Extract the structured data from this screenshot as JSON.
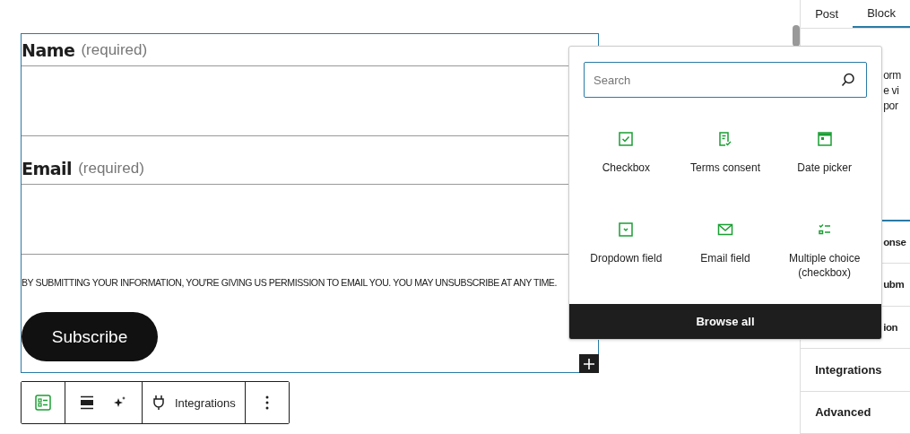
{
  "form": {
    "fields": [
      {
        "label": "Name",
        "hint": "(required)"
      },
      {
        "label": "Email",
        "hint": "(required)"
      }
    ],
    "disclaimer": "BY SUBMITTING YOUR INFORMATION, YOU'RE GIVING US PERMISSION TO EMAIL YOU. YOU MAY UNSUBSCRIBE AT ANY TIME.",
    "submit": "Subscribe"
  },
  "toolbar": {
    "integrations": "Integrations"
  },
  "inserter": {
    "search": {
      "placeholder": "Search"
    },
    "blocks": [
      {
        "label": "Checkbox",
        "kind": "checkbox"
      },
      {
        "label": "Terms consent",
        "kind": "consent"
      },
      {
        "label": "Date picker",
        "kind": "date"
      },
      {
        "label": "Dropdown field",
        "kind": "dropdown"
      },
      {
        "label": "Email field",
        "kind": "email"
      },
      {
        "label": "Multiple choice (checkbox)",
        "kind": "multi"
      }
    ],
    "browse_all": "Browse all"
  },
  "sidebar": {
    "tabs": [
      {
        "label": "Post",
        "selected": false
      },
      {
        "label": "Block",
        "selected": true
      }
    ],
    "description_fragments": [
      "orm",
      "e vi",
      "por"
    ],
    "sections": [
      "onse",
      "ubm",
      "ion",
      "Integrations",
      "Advanced"
    ]
  }
}
